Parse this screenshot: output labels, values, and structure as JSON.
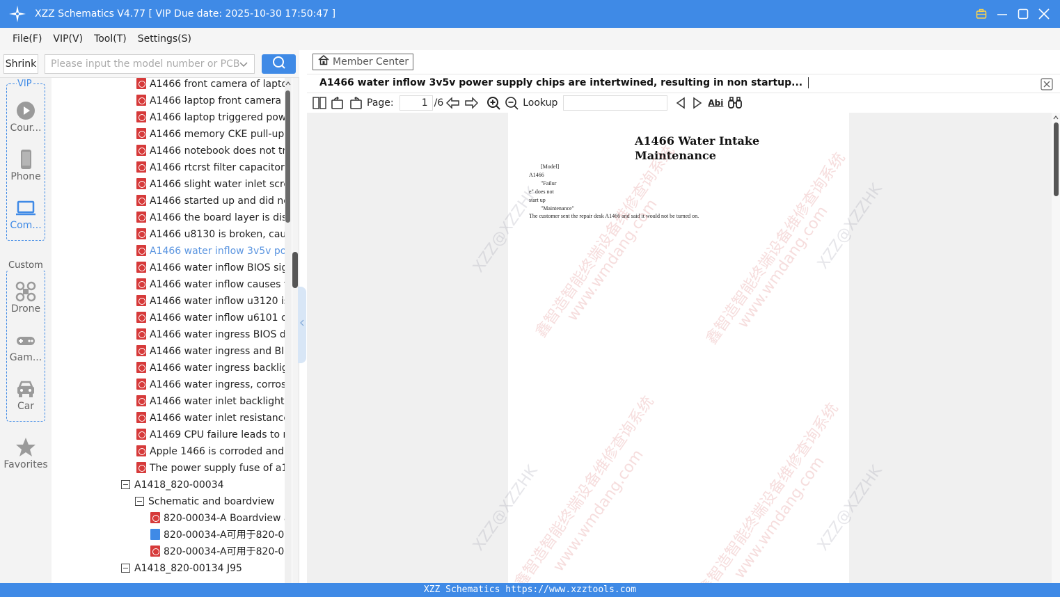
{
  "window": {
    "title": "XZZ Schematics V4.77 [ VIP Due date: 2025-10-30 17:50:47 ]",
    "accent": "#3f8ae6"
  },
  "menu": [
    "File(F)",
    "VIP(V)",
    "Tool(T)",
    "Settings(S)"
  ],
  "search": {
    "shrink_label": "Shrink",
    "placeholder": "Please input the model number or PCB"
  },
  "sidebar": {
    "vip_group_label": "VIP",
    "custom_group_label": "Custom",
    "items": [
      {
        "label": "Cour...",
        "icon": "play-circle-icon"
      },
      {
        "label": "Phone",
        "icon": "phone-icon"
      },
      {
        "label": "Com...",
        "icon": "laptop-icon"
      },
      {
        "label": "Drone",
        "icon": "drone-icon"
      },
      {
        "label": "Gam...",
        "icon": "gamepad-icon"
      },
      {
        "label": "Car",
        "icon": "car-icon"
      },
      {
        "label": "Favorites",
        "icon": "star-icon"
      }
    ]
  },
  "tree": {
    "rows": [
      {
        "type": "pdf",
        "level": 2,
        "text": "A1466 front camera of laptop",
        "selected": false
      },
      {
        "type": "pdf",
        "level": 2,
        "text": "A1466 laptop front camera c",
        "selected": false
      },
      {
        "type": "pdf",
        "level": 2,
        "text": "A1466 laptop triggered powe",
        "selected": false
      },
      {
        "type": "pdf",
        "level": 2,
        "text": "A1466 memory CKE pull-up r",
        "selected": false
      },
      {
        "type": "pdf",
        "level": 2,
        "text": "A1466 notebook does not tri",
        "selected": false
      },
      {
        "type": "pdf",
        "level": 2,
        "text": "A1466 rtcrst filter capacitor is",
        "selected": false
      },
      {
        "type": "pdf",
        "level": 2,
        "text": "A1466 slight water inlet scree",
        "selected": false
      },
      {
        "type": "pdf",
        "level": 2,
        "text": "A1466 started up and did no",
        "selected": false
      },
      {
        "type": "pdf",
        "level": 2,
        "text": "A1466 the board layer is disc",
        "selected": false
      },
      {
        "type": "pdf",
        "level": 2,
        "text": "A1466 u8130 is broken, caus",
        "selected": false
      },
      {
        "type": "pdf",
        "level": 2,
        "text": "A1466 water inflow 3v5v pov",
        "selected": true
      },
      {
        "type": "pdf",
        "level": 2,
        "text": "A1466 water inflow BIOS sigr",
        "selected": false
      },
      {
        "type": "pdf",
        "level": 2,
        "text": "A1466 water inflow causes th",
        "selected": false
      },
      {
        "type": "pdf",
        "level": 2,
        "text": "A1466 water inflow u3120 is",
        "selected": false
      },
      {
        "type": "pdf",
        "level": 2,
        "text": "A1466 water inflow u6101 cc",
        "selected": false
      },
      {
        "type": "pdf",
        "level": 2,
        "text": "A1466 water ingress BIOS dis",
        "selected": false
      },
      {
        "type": "pdf",
        "level": 2,
        "text": "A1466 water ingress and BIO",
        "selected": false
      },
      {
        "type": "pdf",
        "level": 2,
        "text": "A1466 water ingress backligh",
        "selected": false
      },
      {
        "type": "pdf",
        "level": 2,
        "text": "A1466 water ingress, corrosic",
        "selected": false
      },
      {
        "type": "pdf",
        "level": 2,
        "text": "A1466 water inlet backlight f",
        "selected": false
      },
      {
        "type": "pdf",
        "level": 2,
        "text": "A1466 water inlet resistance",
        "selected": false
      },
      {
        "type": "pdf",
        "level": 2,
        "text": "A1469 CPU failure leads to n",
        "selected": false
      },
      {
        "type": "pdf",
        "level": 2,
        "text": "Apple 1466 is corroded and c",
        "selected": false
      },
      {
        "type": "pdf",
        "level": 2,
        "text": "The power supply fuse of a14",
        "selected": false
      },
      {
        "type": "folder",
        "level": 1,
        "text": "A1418_820-00034",
        "selected": false
      },
      {
        "type": "folder",
        "level": 2,
        "text": "Schematic and boardview",
        "selected": false
      },
      {
        "type": "pdf",
        "level": 3,
        "text": "820-00034-A Boardview a",
        "selected": false
      },
      {
        "type": "img",
        "level": 3,
        "text": "820-00034-A可用于820-00",
        "selected": false
      },
      {
        "type": "pdf",
        "level": 3,
        "text": "820-00034-A可用于820-00",
        "selected": false
      },
      {
        "type": "folder",
        "level": 1,
        "text": "A1418_820-00134 J95",
        "selected": false
      }
    ]
  },
  "right": {
    "member_center": "Member Center",
    "doc_title": "A1466 water inflow 3v5v power supply chips are intertwined, resulting in non startup...",
    "page_label": "Page:",
    "page_current": "1",
    "page_total": "/6",
    "lookup_label": "Lookup",
    "abi_label": "Abi"
  },
  "document": {
    "heading_line1": "A1466 Water Intake",
    "heading_line2": "Maintenance",
    "lines": [
      "[Model]",
      "A1466",
      "\"Failur",
      "e\" does not",
      "start up",
      "\"Maintenance\"",
      "The customer sent the repair desk A1466 and said it would not be turned on."
    ],
    "watermarks": [
      "鑫智造智能终端设备维修查询系统",
      "www.wmdang.com",
      "XZZ@XZZHK"
    ]
  },
  "statusbar": {
    "text": "XZZ Schematics https://www.xzztools.com"
  }
}
